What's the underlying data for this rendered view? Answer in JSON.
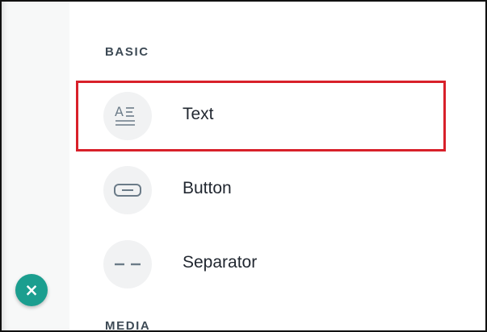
{
  "sections": {
    "basic": {
      "title": "BASIC",
      "items": [
        {
          "label": "Text",
          "icon": "text-format-icon"
        },
        {
          "label": "Button",
          "icon": "button-shape-icon"
        },
        {
          "label": "Separator",
          "icon": "separator-icon"
        }
      ]
    },
    "media": {
      "title": "MEDIA"
    }
  },
  "fab": {
    "glyph": "×",
    "icon": "close-icon"
  },
  "colors": {
    "highlight": "#d8202a",
    "fab": "#1b9e8f",
    "section_title": "#3d4a55",
    "icon_background": "#f1f2f3",
    "icon_stroke": "#6b7b88"
  }
}
